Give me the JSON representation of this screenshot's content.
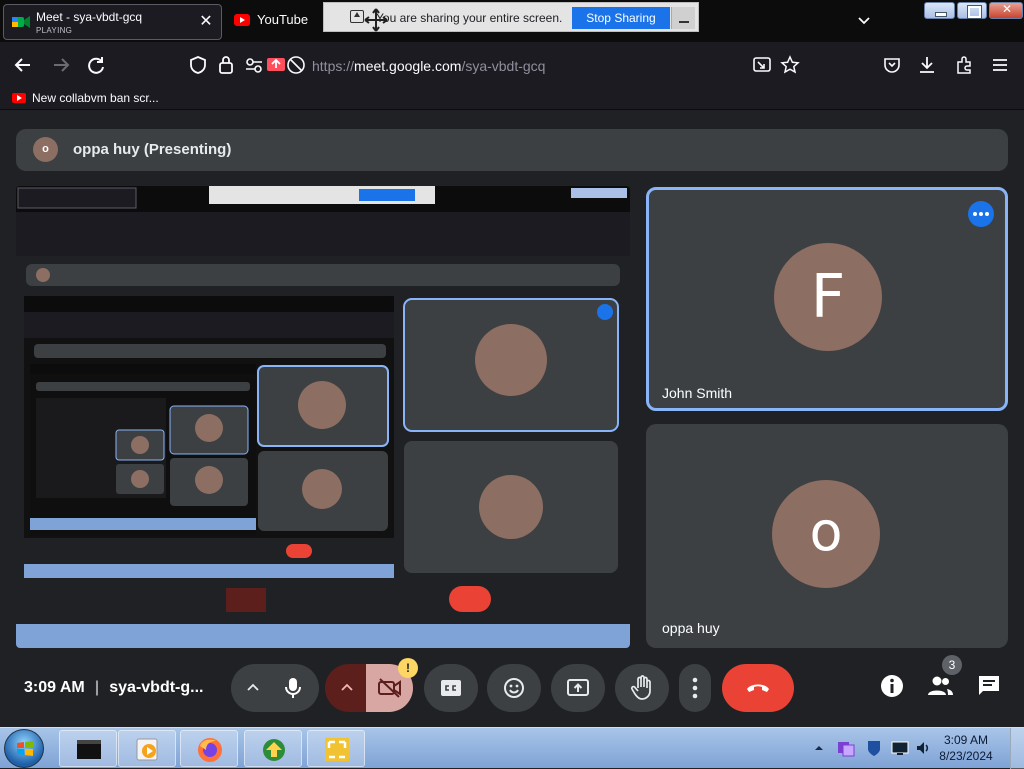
{
  "browser": {
    "active_tab": {
      "title": "Meet - sya-vbdt-gcq",
      "status": "PLAYING",
      "close_glyph": "✕"
    },
    "second_tab": {
      "title": "YouTube"
    },
    "sharing_bar": {
      "text": "You are sharing your entire screen.",
      "stop_label": "Stop Sharing"
    },
    "url": {
      "prefix": "https://",
      "host": "meet.google.com",
      "path": "/sya-vbdt-gcq"
    },
    "bookmark": {
      "label": "New collabvm ban scr..."
    }
  },
  "meet": {
    "presenting_avatar_letter": "o",
    "presenting_label": "oppa huy (Presenting)",
    "participants": [
      {
        "name": "John Smith",
        "initial": "F",
        "avatar_color": "#8d6e63",
        "speaking": true
      },
      {
        "name": "oppa huy",
        "initial": "o",
        "avatar_color": "#8d6e63",
        "speaking": false
      }
    ],
    "controls": {
      "time": "3:09 AM",
      "meeting_code": "sya-vbdt-g...",
      "people_count": "3",
      "warning_glyph": "!"
    },
    "colors": {
      "end_call": "#ea4335",
      "accent": "#1a73e8",
      "camera_off_bg": "#5c1f1c",
      "camera_off_btn": "#d9a7a3"
    }
  },
  "taskbar": {
    "time": "3:09 AM",
    "date": "8/23/2024"
  }
}
